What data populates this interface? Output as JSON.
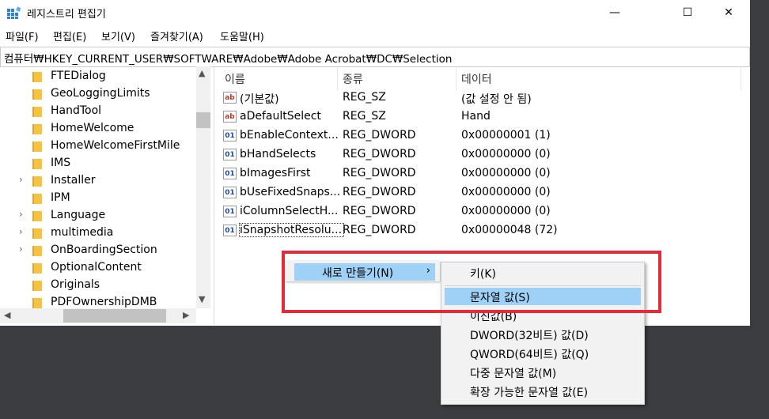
{
  "window": {
    "title": "레지스트리 편집기",
    "minimize": "—",
    "maximize": "☐",
    "close": "✕"
  },
  "menu": [
    "파일(F)",
    "편집(E)",
    "보기(V)",
    "즐겨찾기(A)",
    "도움말(H)"
  ],
  "address": "컴퓨터₩HKEY_CURRENT_USER₩SOFTWARE₩Adobe₩Adobe Acrobat₩DC₩Selection",
  "tree": [
    {
      "label": "FTEDialog",
      "expandable": false
    },
    {
      "label": "GeoLoggingLimits",
      "expandable": false
    },
    {
      "label": "HandTool",
      "expandable": false
    },
    {
      "label": "HomeWelcome",
      "expandable": false
    },
    {
      "label": "HomeWelcomeFirstMile",
      "expandable": false
    },
    {
      "label": "IMS",
      "expandable": false
    },
    {
      "label": "Installer",
      "expandable": true
    },
    {
      "label": "IPM",
      "expandable": false
    },
    {
      "label": "Language",
      "expandable": true
    },
    {
      "label": "multimedia",
      "expandable": true
    },
    {
      "label": "OnBoardingSection",
      "expandable": true
    },
    {
      "label": "OptionalContent",
      "expandable": false
    },
    {
      "label": "Originals",
      "expandable": false
    },
    {
      "label": "PDFOwnershipDMB",
      "expandable": false
    }
  ],
  "columns": [
    "이름",
    "종류",
    "데이터"
  ],
  "values": [
    {
      "icon": "string-value-icon",
      "name": "(기본값)",
      "type": "REG_SZ",
      "data": "(값 설정 안 됨)"
    },
    {
      "icon": "string-value-icon",
      "name": "aDefaultSelect",
      "type": "REG_SZ",
      "data": "Hand"
    },
    {
      "icon": "dword-value-icon",
      "name": "bEnableContext...",
      "type": "REG_DWORD",
      "data": "0x00000001 (1)"
    },
    {
      "icon": "dword-value-icon",
      "name": "bHandSelects",
      "type": "REG_DWORD",
      "data": "0x00000000 (0)"
    },
    {
      "icon": "dword-value-icon",
      "name": "bImagesFirst",
      "type": "REG_DWORD",
      "data": "0x00000000 (0)"
    },
    {
      "icon": "dword-value-icon",
      "name": "bUseFixedSnaps...",
      "type": "REG_DWORD",
      "data": "0x00000000 (0)"
    },
    {
      "icon": "dword-value-icon",
      "name": "iColumnSelectH...",
      "type": "REG_DWORD",
      "data": "0x00000000 (0)"
    },
    {
      "icon": "dword-value-icon",
      "name": "iSnapshotResolu...",
      "type": "REG_DWORD",
      "data": "0x00000048 (72)"
    }
  ],
  "context_menu": {
    "item": "새로 만들기(N)",
    "chevron": "›"
  },
  "submenu": [
    "키(K)",
    "문자열 값(S)",
    "이진값(B)",
    "DWORD(32비트) 값(D)",
    "QWORD(64비트) 값(Q)",
    "다중 문자열 값(M)",
    "확장 가능한 문자열 값(E)"
  ],
  "highlight_color": "#e52b35",
  "selection_color": "#9fd0f5"
}
